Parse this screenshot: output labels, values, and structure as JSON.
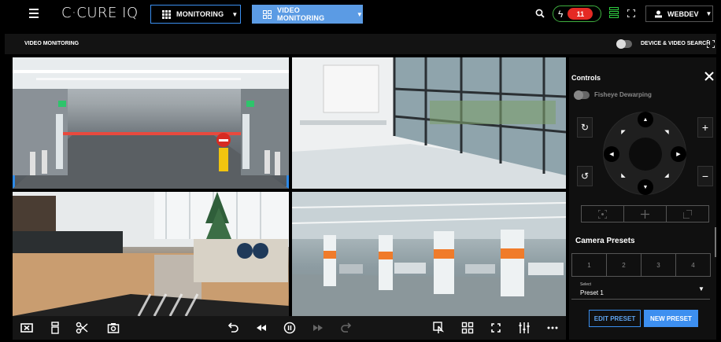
{
  "app": {
    "brand": "C·CURE IQ",
    "colors": {
      "accent": "#3a8ff0",
      "alert": "#e52a24",
      "ok": "#2ecc40",
      "selected_tile": "#2d8ae8"
    }
  },
  "topbar": {
    "menu_icon": "hamburger-icon",
    "nav_monitoring": {
      "label": "MONITORING",
      "icon": "grid-icon"
    },
    "nav_video": {
      "label": "VIDEO MONITORING",
      "icon": "dashboard-icon"
    },
    "search_icon": "search-icon",
    "alarm_count": "11",
    "alarm_icon": "bolt-icon",
    "server_icon": "server-status-icon",
    "fullscreen_icon": "fullscreen-icon",
    "user": {
      "name": "WEBDEV",
      "icon": "user-icon"
    }
  },
  "header": {
    "title": "VIDEO MONITORING",
    "device_search_label": "DEVICE & VIDEO SEARCH",
    "device_search_on": false
  },
  "video_tiles": [
    {
      "scene": "parking-barrier-entrance",
      "selected": true
    },
    {
      "scene": "glass-lobby"
    },
    {
      "scene": "hotel-reception"
    },
    {
      "scene": "underground-parking"
    }
  ],
  "toolbar": {
    "icons": [
      "close-stream-icon",
      "camera-device-icon",
      "cut-icon",
      "snapshot-icon",
      "undo-icon",
      "rewind-icon",
      "pause-icon",
      "fast-forward-icon",
      "redo-icon",
      "touch-icon",
      "layout-grid-icon",
      "fullscreen-icon",
      "adjust-icon",
      "more-icon"
    ]
  },
  "controls": {
    "title": "Controls",
    "fisheye_label": "Fisheye Dewarping",
    "fisheye_on": false,
    "presets_title": "Camera Presets",
    "presets": [
      "1",
      "2",
      "3",
      "4"
    ],
    "select_label": "Select",
    "select_value": "Preset 1",
    "edit_label": "EDIT PRESET",
    "new_label": "NEW PRESET"
  }
}
